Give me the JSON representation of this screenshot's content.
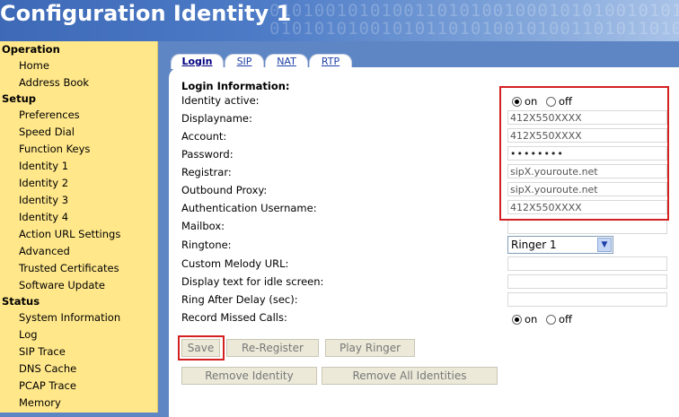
{
  "header": {
    "title": "Configuration Identity 1",
    "bits": "0101001010100110101001000101010010101\n0101010100101011010100101001101011010"
  },
  "sidebar": {
    "sections": [
      {
        "label": "Operation",
        "items": [
          "Home",
          "Address Book"
        ]
      },
      {
        "label": "Setup",
        "items": [
          "Preferences",
          "Speed Dial",
          "Function Keys",
          "Identity 1",
          "Identity 2",
          "Identity 3",
          "Identity 4",
          "Action URL Settings",
          "Advanced",
          "Trusted Certificates",
          "Software Update"
        ]
      },
      {
        "label": "Status",
        "items": [
          "System Information",
          "Log",
          "SIP Trace",
          "DNS Cache",
          "PCAP Trace",
          "Memory"
        ]
      }
    ]
  },
  "tabs": [
    "Login",
    "SIP",
    "NAT",
    "RTP"
  ],
  "form": {
    "section_title": "Login Information:",
    "labels": {
      "identity_active": "Identity active:",
      "displayname": "Displayname:",
      "account": "Account:",
      "password": "Password:",
      "registrar": "Registrar:",
      "outbound_proxy": "Outbound Proxy:",
      "auth_username": "Authentication Username:",
      "mailbox": "Mailbox:",
      "ringtone": "Ringtone:",
      "custom_melody_url": "Custom Melody URL:",
      "display_text_idle": "Display text for idle screen:",
      "ring_after_delay": "Ring After Delay (sec):",
      "record_missed_calls": "Record Missed Calls:"
    },
    "values": {
      "displayname": "412X550XXXX",
      "account": "412X550XXXX",
      "password": "••••••••",
      "registrar": "sipX.youroute.net",
      "outbound_proxy": "sipX.youroute.net",
      "auth_username": "412X550XXXX",
      "mailbox": "",
      "ringtone": "Ringer 1",
      "custom_melody_url": "",
      "display_text_idle": "",
      "ring_after_delay": ""
    },
    "radio": {
      "on": "on",
      "off": "off"
    },
    "selection": {
      "identity_active": "on",
      "record_missed_calls": "on"
    }
  },
  "buttons": {
    "save": "Save",
    "re_register": "Re-Register",
    "play_ringer": "Play Ringer",
    "remove_identity": "Remove Identity",
    "remove_all_identities": "Remove All Identities"
  },
  "colors": {
    "highlight": "#d42020",
    "sidebar_bg": "#ffe78a",
    "header_bg": "#3d69b6"
  }
}
